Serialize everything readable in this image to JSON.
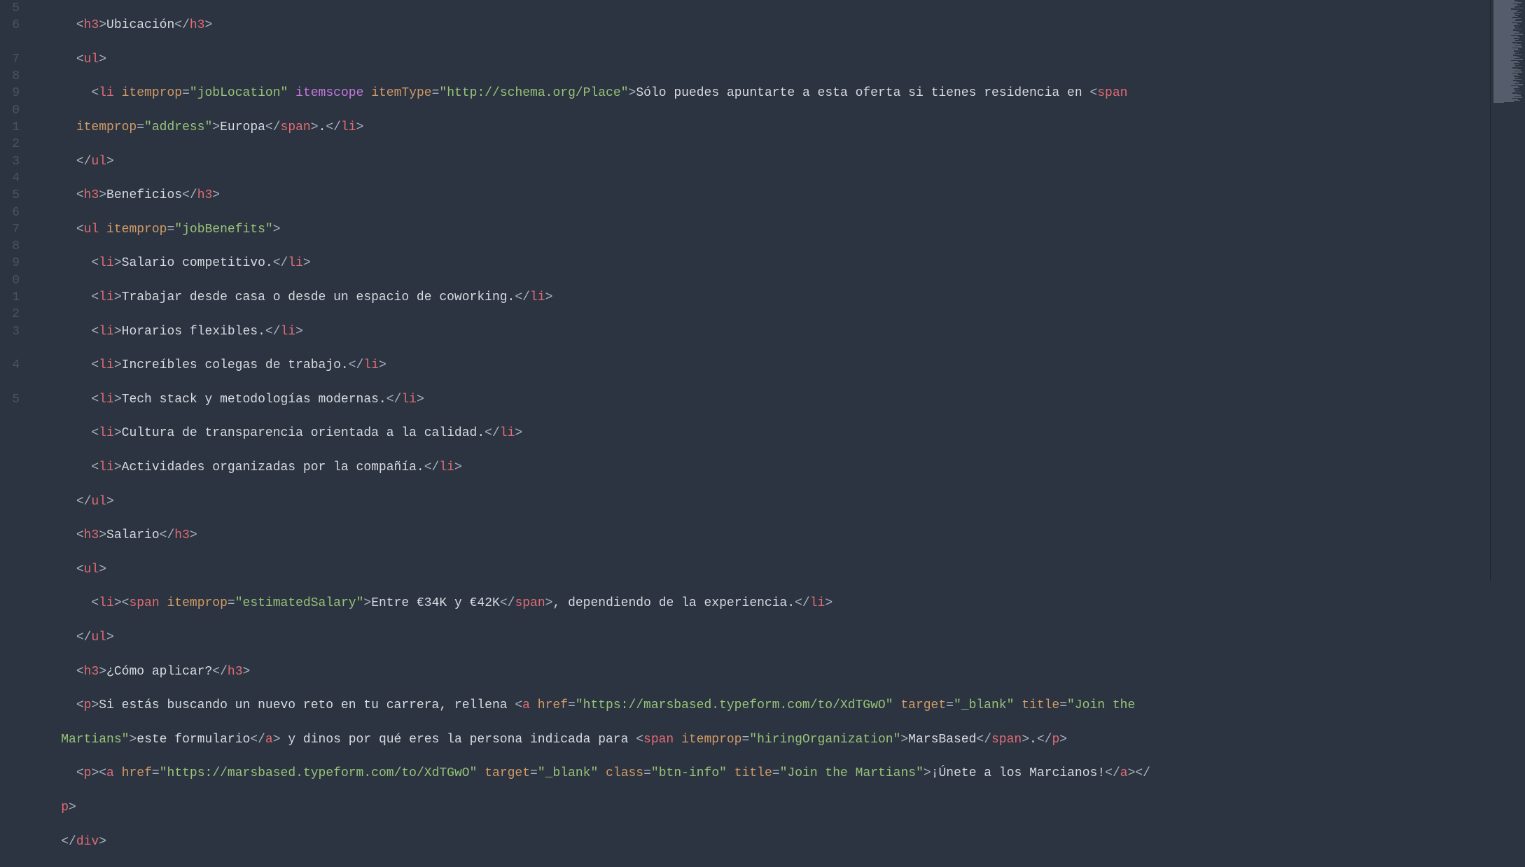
{
  "gutter": [
    "5",
    "6",
    "",
    "7",
    "8",
    "9",
    "0",
    "1",
    "2",
    "3",
    "4",
    "5",
    "6",
    "7",
    "8",
    "9",
    "0",
    "1",
    "2",
    "3",
    "",
    "4",
    "",
    "5"
  ],
  "code": {
    "l1": {
      "ind": "      ",
      "t1": "h3",
      "tx": "Ubicación",
      "t2": "h3"
    },
    "l2": {
      "ind": "      ",
      "t": "ul"
    },
    "l3a": {
      "ind": "        ",
      "t": "li",
      "a1": "itemprop",
      "v1": "jobLocation",
      "a2": "itemscope",
      "a3": "itemType",
      "v3": "http://schema.org/Place",
      "tx1": "Sólo puedes apuntarte a esta oferta si tienes residencia en ",
      "t2": "span"
    },
    "l3b": {
      "ind": "      ",
      "a": "itemprop",
      "v": "address",
      "tx": "Europa",
      "t1": "span",
      "dot": ".",
      "t2": "li"
    },
    "l4": {
      "ind": "      ",
      "t": "ul"
    },
    "l5": {
      "ind": "      ",
      "t": "h3",
      "tx": "Beneficios"
    },
    "l6": {
      "ind": "      ",
      "t": "ul",
      "a": "itemprop",
      "v": "jobBenefits"
    },
    "l7": {
      "ind": "        ",
      "t": "li",
      "tx": "Salario competitivo."
    },
    "l8": {
      "ind": "        ",
      "t": "li",
      "tx": "Trabajar desde casa o desde un espacio de coworking."
    },
    "l9": {
      "ind": "        ",
      "t": "li",
      "tx": "Horarios flexibles."
    },
    "l10": {
      "ind": "        ",
      "t": "li",
      "tx": "Increíbles colegas de trabajo."
    },
    "l11": {
      "ind": "        ",
      "t": "li",
      "tx": "Tech stack y metodologías modernas."
    },
    "l12": {
      "ind": "        ",
      "t": "li",
      "tx": "Cultura de transparencia orientada a la calidad."
    },
    "l13": {
      "ind": "        ",
      "t": "li",
      "tx": "Actividades organizadas por la compañía."
    },
    "l14": {
      "ind": "      ",
      "t": "ul"
    },
    "l15": {
      "ind": "      ",
      "t": "h3",
      "tx": "Salario"
    },
    "l16": {
      "ind": "      ",
      "t": "ul"
    },
    "l17": {
      "ind": "        ",
      "t1": "li",
      "t2": "span",
      "a": "itemprop",
      "v": "estimatedSalary",
      "tx1": "Entre €34K y €42K",
      "tx2": ", dependiendo de la experiencia."
    },
    "l18": {
      "ind": "      ",
      "t": "ul"
    },
    "l19": {
      "ind": "      ",
      "t": "h3",
      "tx": "¿Cómo aplicar?"
    },
    "l20a": {
      "ind": "      ",
      "t": "p",
      "tx1": "Si estás buscando un nuevo reto en tu carrera, rellena ",
      "t2": "a",
      "a1": "href",
      "v1": "https://marsbased.typeform.com/to/XdTGwO",
      "a2": "target",
      "v2": "_blank",
      "a3": "title",
      "v3": "Join the"
    },
    "l20b": {
      "ind": "    ",
      "v3b": "Martians",
      "tx1": "este formulario",
      "t1": "a",
      "tx2": " y dinos por qué eres la persona indicada para ",
      "t2": "span",
      "a": "itemprop",
      "v": "hiringOrganization",
      "tx3": "MarsBased",
      "dot": ".",
      "t3": "p"
    },
    "l21a": {
      "ind": "      ",
      "t1": "p",
      "t2": "a",
      "a1": "href",
      "v1": "https://marsbased.typeform.com/to/XdTGwO",
      "a2": "target",
      "v2": "_blank",
      "a3": "class",
      "v3": "btn-info",
      "a4": "title",
      "v4": "Join the Martians",
      "tx": "¡Únete a los Marcianos!",
      "t3": "a"
    },
    "l21b": {
      "ind": "    ",
      "t": "p"
    },
    "l22": {
      "ind": "    ",
      "t": "div"
    }
  }
}
